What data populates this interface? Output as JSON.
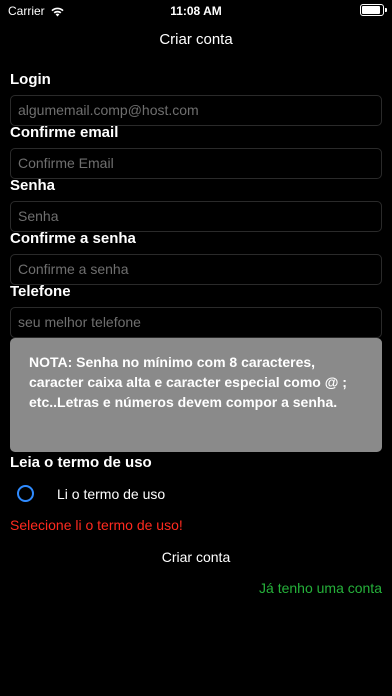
{
  "status_bar": {
    "carrier": "Carrier",
    "time": "11:08 AM",
    "battery_level": 0.95,
    "icons": [
      "wifi-icon",
      "battery-icon"
    ]
  },
  "nav": {
    "title": "Criar conta"
  },
  "form": {
    "login": {
      "label": "Login",
      "placeholder": "algumemail.comp@host.com"
    },
    "confirm_email": {
      "label": "Confirme email",
      "placeholder": "Confirme Email"
    },
    "password": {
      "label": "Senha",
      "placeholder": "Senha"
    },
    "confirm_password": {
      "label": "Confirme a senha",
      "placeholder": "Confirme a senha"
    },
    "phone": {
      "label": "Telefone",
      "placeholder": "seu melhor telefone"
    }
  },
  "note": {
    "text": "NOTA: Senha no mínimo com 8 caracteres, caracter caixa alta e caracter especial como @ ; etc..Letras e números devem compor a senha."
  },
  "terms": {
    "heading": "Leia o termo de uso",
    "radio_label": "Li o termo de uso",
    "radio_selected": false,
    "error": "Selecione li o termo de uso!"
  },
  "actions": {
    "submit_label": "Criar conta",
    "login_link": "Já tenho uma conta"
  },
  "colors": {
    "background": "#000000",
    "note_background": "#8a8a8a",
    "radio": "#2f8bff",
    "error": "#ff2a1f",
    "link": "#25b13a"
  }
}
